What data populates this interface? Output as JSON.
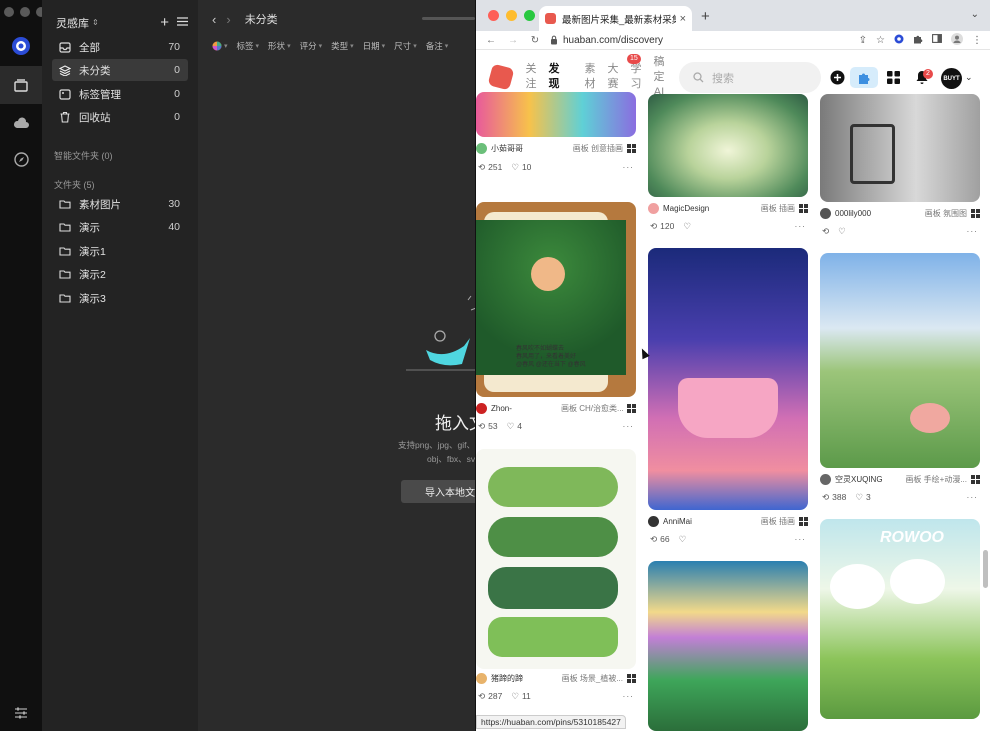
{
  "app": {
    "library_name": "灵感库",
    "nav": [
      {
        "label": "全部",
        "count": "70",
        "icon": "inbox-icon"
      },
      {
        "label": "未分类",
        "count": "0",
        "icon": "layers-icon"
      },
      {
        "label": "标签管理",
        "count": "0",
        "icon": "tag-icon"
      },
      {
        "label": "回收站",
        "count": "0",
        "icon": "trash-icon"
      }
    ],
    "smart_folders_label": "智能文件夹 (0)",
    "folders_label": "文件夹 (5)",
    "folders": [
      {
        "label": "素材图片",
        "count": "30"
      },
      {
        "label": "演示",
        "count": "40"
      },
      {
        "label": "演示1",
        "count": ""
      },
      {
        "label": "演示2",
        "count": ""
      },
      {
        "label": "演示3",
        "count": ""
      }
    ],
    "main_title": "未分类",
    "filters": [
      "标签",
      "形状",
      "评分",
      "类型",
      "日期",
      "尺寸",
      "备注"
    ],
    "drop_title": "拖入文",
    "drop_hint1": "支持png、jpg、gif、r",
    "drop_hint2": "obj、fbx、sv",
    "import_button": "导入本地文件"
  },
  "browser": {
    "tab_title": "最新图片采集_最新素材采集-花瓣",
    "url": "huaban.com/discovery",
    "status_url": "https://huaban.com/pins/5310185427",
    "site_nav": [
      {
        "label": "关注",
        "current": false
      },
      {
        "label": "发现",
        "current": true
      },
      {
        "label": "素材",
        "current": false
      },
      {
        "label": "大赛",
        "current": false
      },
      {
        "label": "学习",
        "current": false,
        "badge": "15"
      },
      {
        "label": "稿定AI",
        "current": false
      }
    ],
    "search_placeholder": "搜索",
    "notification_count": "2",
    "avatar_text": "BUYT"
  },
  "pins": {
    "col1": [
      {
        "user": "小茹哥哥",
        "board": "画板 创意插画",
        "saves": "251",
        "likes": "10"
      },
      {
        "user": "Zhon-",
        "board": "画板 CH/治愈类...",
        "saves": "53",
        "likes": "4"
      },
      {
        "user": "猪蹄的蹄",
        "board": "画板 场景_植被...",
        "saves": "287",
        "likes": "11"
      }
    ],
    "col2": [
      {
        "user": "MagicDesign",
        "board": "画板 插画",
        "saves": "120",
        "likes": ""
      },
      {
        "user": "AnniMai",
        "board": "画板 插画",
        "saves": "66",
        "likes": ""
      }
    ],
    "col3": [
      {
        "user": "000lily000",
        "board": "画板 氛围图",
        "saves": "",
        "likes": ""
      },
      {
        "user": "空灵XUQING",
        "board": "画板 手绘+动漫...",
        "saves": "388",
        "likes": "3"
      }
    ],
    "card_text_1": "春风吹不如蝴蝶去\n春风用了，来看着美好\n@春风 @还在当下 @春风",
    "card_label_2": "ROWOO"
  }
}
